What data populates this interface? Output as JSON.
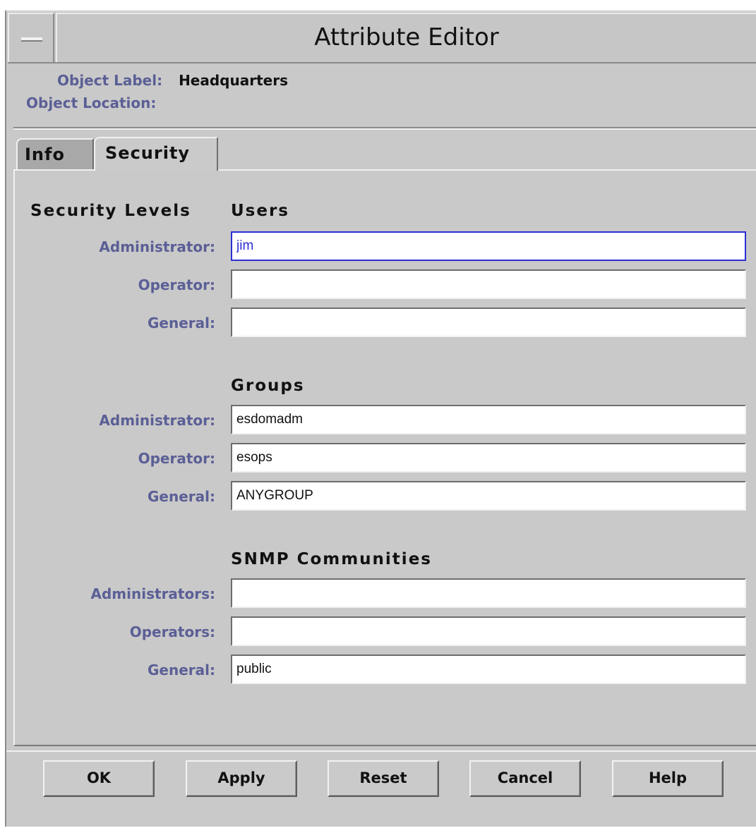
{
  "window": {
    "title": "Attribute Editor"
  },
  "object": {
    "label_caption": "Object Label:",
    "label_value": "Headquarters",
    "location_caption": "Object Location:",
    "location_value": ""
  },
  "tabs": [
    {
      "label": "Info",
      "active": false
    },
    {
      "label": "Security",
      "active": true
    }
  ],
  "security": {
    "levels_heading": "Security Levels",
    "users": {
      "heading": "Users",
      "fields": [
        {
          "label": "Administrator:",
          "value": "jim"
        },
        {
          "label": "Operator:",
          "value": ""
        },
        {
          "label": "General:",
          "value": ""
        }
      ]
    },
    "groups": {
      "heading": "Groups",
      "fields": [
        {
          "label": "Administrator:",
          "value": "esdomadm"
        },
        {
          "label": "Operator:",
          "value": "esops"
        },
        {
          "label": "General:",
          "value": "ANYGROUP"
        }
      ]
    },
    "snmp": {
      "heading": "SNMP Communities",
      "fields": [
        {
          "label": "Administrators:",
          "value": ""
        },
        {
          "label": "Operators:",
          "value": ""
        },
        {
          "label": "General:",
          "value": "public"
        }
      ]
    }
  },
  "buttons": {
    "ok": "OK",
    "apply": "Apply",
    "reset": "Reset",
    "cancel": "Cancel",
    "help": "Help"
  },
  "colors": {
    "window_bg": "#c9c9c9",
    "label_text": "#5b5f96",
    "focus_border": "#2b2fd6"
  }
}
